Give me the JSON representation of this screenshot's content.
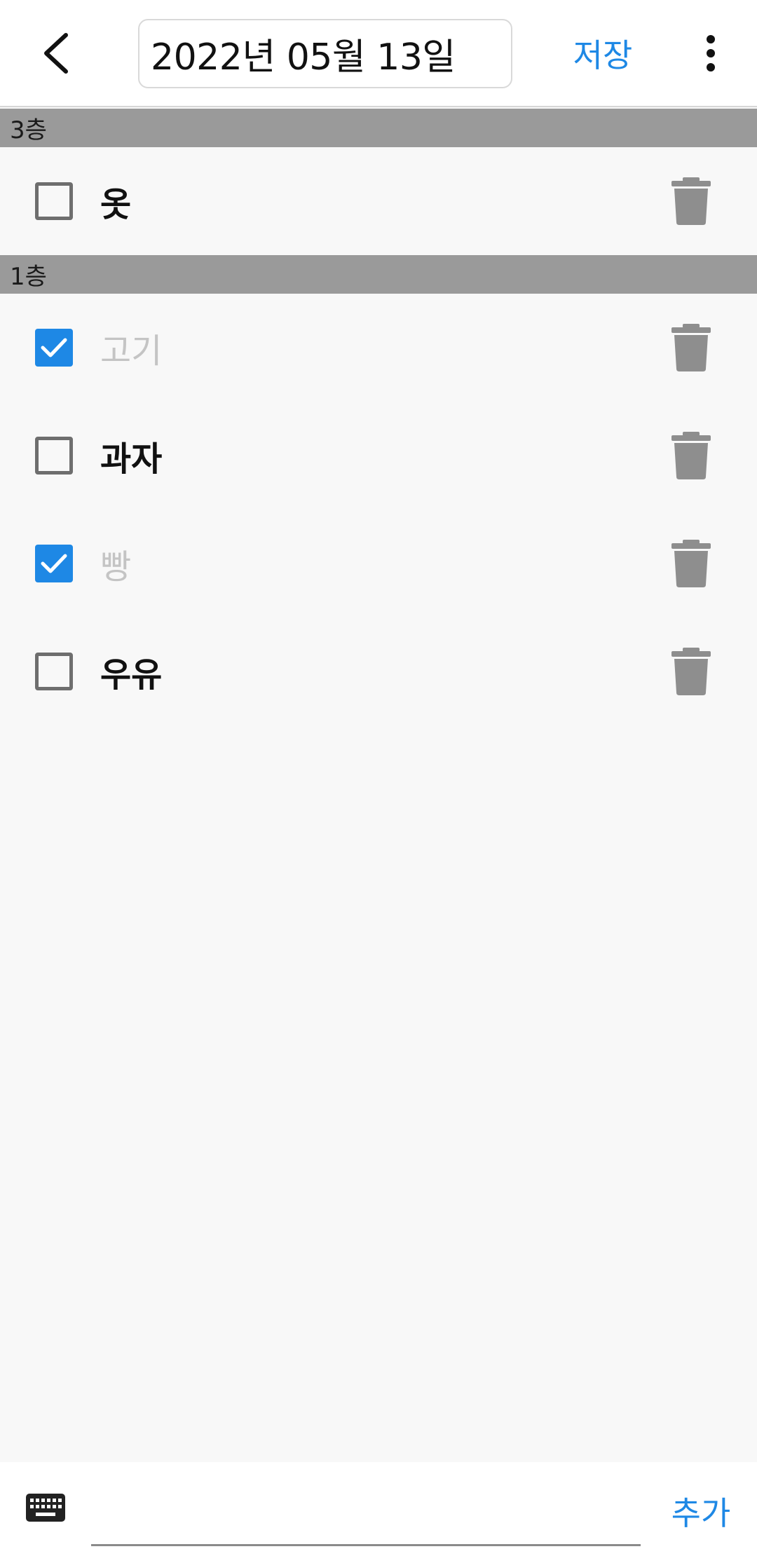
{
  "toolbar": {
    "title": "2022년 05월 13일",
    "save_label": "저장",
    "back_icon": "chevron-left-icon",
    "more_icon": "more-vert-icon"
  },
  "sections": [
    {
      "title": "3층",
      "items": [
        {
          "label": "옷",
          "checked": false
        }
      ]
    },
    {
      "title": "1층",
      "items": [
        {
          "label": "고기",
          "checked": true
        },
        {
          "label": "과자",
          "checked": false
        },
        {
          "label": "빵",
          "checked": true
        },
        {
          "label": "우유",
          "checked": false
        }
      ]
    }
  ],
  "bottom_bar": {
    "keyboard_icon": "keyboard-icon",
    "input_value": "",
    "add_label": "추가"
  },
  "colors": {
    "accent": "#1e88e5",
    "section_bg": "#9a9a9a",
    "done_text": "#c4c4c4",
    "trash": "#8e8e8e"
  }
}
